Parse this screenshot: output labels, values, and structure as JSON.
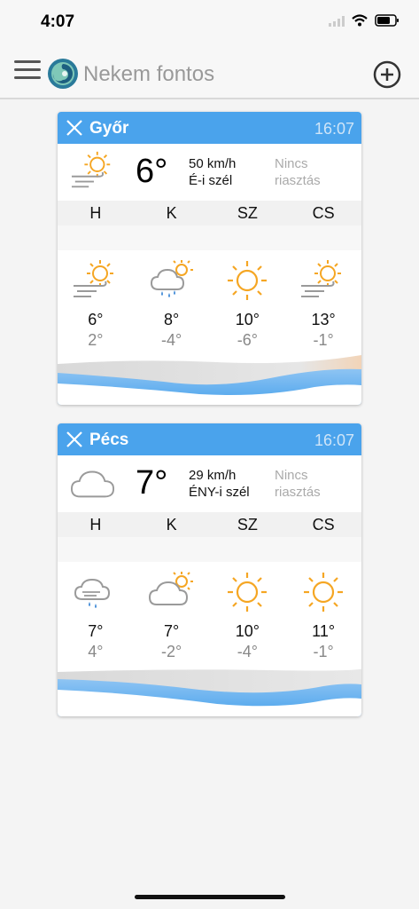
{
  "status": {
    "time": "4:07"
  },
  "app": {
    "title": "Nekem fontos"
  },
  "cards": [
    {
      "city": "Győr",
      "updated": "16:07",
      "current": {
        "icon": "sun-wind-icon",
        "temp": "6°",
        "wind_speed": "50 km/h",
        "wind_dir": "É-i szél",
        "alert_line1": "Nincs",
        "alert_line2": "riasztás"
      },
      "days": [
        "H",
        "K",
        "SZ",
        "CS"
      ],
      "forecast": [
        {
          "icon": "sun-wind-icon",
          "hi": "6°",
          "lo": "2°"
        },
        {
          "icon": "rain-cloud-sun-icon",
          "hi": "8°",
          "lo": "-4°"
        },
        {
          "icon": "sun-icon",
          "hi": "10°",
          "lo": "-6°"
        },
        {
          "icon": "sun-wind-icon",
          "hi": "13°",
          "lo": "-1°"
        }
      ]
    },
    {
      "city": "Pécs",
      "updated": "16:07",
      "current": {
        "icon": "cloud-icon",
        "temp": "7°",
        "wind_speed": "29 km/h",
        "wind_dir": "ÉNY-i szél",
        "alert_line1": "Nincs",
        "alert_line2": "riasztás"
      },
      "days": [
        "H",
        "K",
        "SZ",
        "CS"
      ],
      "forecast": [
        {
          "icon": "rain-cloud-icon",
          "hi": "7°",
          "lo": "4°"
        },
        {
          "icon": "cloud-sun-icon",
          "hi": "7°",
          "lo": "-2°"
        },
        {
          "icon": "sun-icon",
          "hi": "10°",
          "lo": "-4°"
        },
        {
          "icon": "sun-icon",
          "hi": "11°",
          "lo": "-1°"
        }
      ]
    }
  ],
  "colors": {
    "header": "#4aa3ec",
    "sun": "#f5a623",
    "cloud": "#9a9a9a",
    "rain": "#4a90d9",
    "wave": "#4aa3ec"
  }
}
